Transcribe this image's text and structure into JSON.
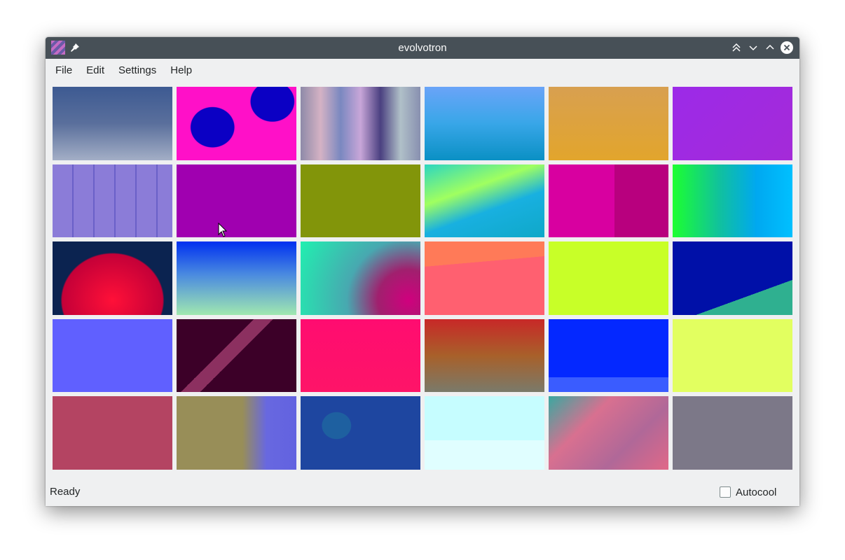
{
  "window": {
    "title": "evolvotron"
  },
  "menu": {
    "items": [
      "File",
      "Edit",
      "Settings",
      "Help"
    ]
  },
  "status": {
    "text": "Ready",
    "autocool_label": "Autocool",
    "autocool_checked": false
  },
  "tiles": [
    "linear-gradient(180deg,#3d5a92 0%,#5a6f9c 50%,#a3aec6 100%)",
    "radial-gradient(ellipse 30% 45% at 30% 55%,#0b00c4 60%,transparent 62%),radial-gradient(ellipse 30% 45% at 80% 20%,#0b00c4 60%,transparent 62%),#ff10c8",
    "linear-gradient(90deg,#8e8aa8,#d4b2c4,#7a88c0,#c8a6d8,#4a4080,#b0c0c8,#8890b0)",
    "linear-gradient(180deg,#6aa4f8 0%,#38a6e8 50%,#0a90c4 100%)",
    "linear-gradient(180deg,#d8a050 0%,#e2a52c 100%)",
    "linear-gradient(135deg,#9c2ae8,#a42ad8)",
    "repeating-linear-gradient(90deg,#8b7cd8 0 28px,#6a60c8 28px 30px),#8b7cd8",
    "#a000b0",
    "#82950a",
    "linear-gradient(160deg,#2cd6c0 0%,#a0ff60 35%,#18b0e0 60%,#0fa8c8 100%)",
    "linear-gradient(90deg,#d800a0 0 55%,#b8007e 55% 100%)",
    "linear-gradient(90deg,#1cff30 0%,#10c0a0 40%,#00a8f0 70%,#00c0ff 100%)",
    "radial-gradient(ellipse 60% 90% at 50% 80%,#ff1038 0%,#c40038 70%,#0b2350 72%)",
    "linear-gradient(180deg,#0030f0 0%,#4a8ae0 45%,#a0e8b0 100%)",
    "radial-gradient(circle at 90% 80%,#d0007e 0%,#a0206e 25%,#48a8b0 50%,#20f0b0 100%)",
    "linear-gradient(175deg,#ff7a58 0 30%,#ff6070 30% 100%)",
    "#c8ff28",
    "linear-gradient(160deg,#0010a8 0 70%,#2fb090 70% 100%)",
    "#6060ff",
    "linear-gradient(135deg,#3c0028 0 40%,#8c3060 40% 50%,#3c0028 50% 100%)",
    "linear-gradient(180deg,#ff0c70 0%,#fe1468 100%)",
    "linear-gradient(180deg,#c82828 0%,#a8602a 50%,#7a7a6a 100%)",
    "linear-gradient(180deg,#0428ff 0 80%,#3a5cff 80% 100%)",
    "#e2ff60",
    "#b44462",
    "linear-gradient(90deg,#988e58 0%,#988e58 55%,#6868e0 75%,#6262e0 100%)",
    "radial-gradient(ellipse 20% 30% at 30% 40%,#1e60a0 60%,transparent 62%),#1e46a0",
    "linear-gradient(180deg,#c6fdff 0 60%,#e0feff 60% 100%)",
    "linear-gradient(135deg,#3aa8a0,#d87090,#b06898,#e06888)",
    "#7c7888"
  ]
}
